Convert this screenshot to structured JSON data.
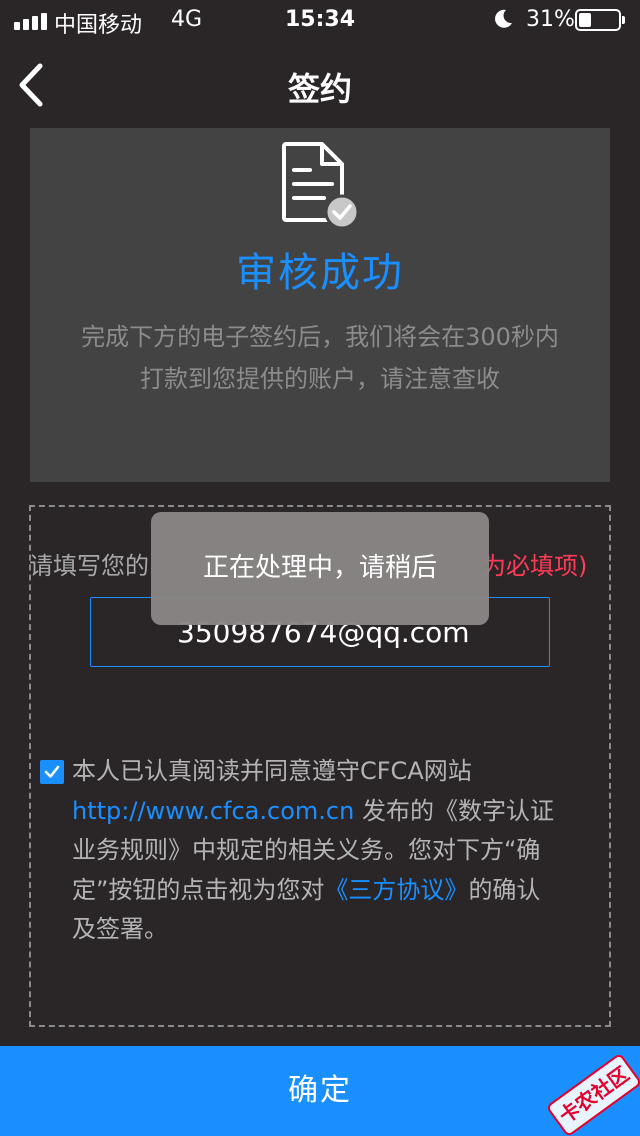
{
  "status_bar": {
    "carrier": "中国移动",
    "network": "4G",
    "time": "15:34",
    "battery": "31%",
    "battery_level": 0.31
  },
  "nav": {
    "title": "签约"
  },
  "card": {
    "headline": "审核成功",
    "description_line1": "完成下方的电子签约后，我们将会在300秒内",
    "description_line2": "打款到您提供的账户，请注意查收"
  },
  "form": {
    "label": "请填写您的",
    "required_note": "为必填项)",
    "email_value": "350987674@qq.com"
  },
  "agreement": {
    "checked": true,
    "text_1": "本人已认真阅读并同意遵守CFCA网站",
    "link_url": "http://www.cfca.com.cn",
    "text_2": " 发布的《数字认证业务规则》中规定的相关义务。您对下方“确定”按钮的点击视为您对",
    "link_agreement": "《三方协议》",
    "text_3": "的确认及签署。"
  },
  "toast": {
    "message": "正在处理中，请稍后"
  },
  "footer": {
    "confirm_label": "确定"
  },
  "watermark": {
    "text": "卡农社区"
  },
  "colors": {
    "accent": "#1a8fff",
    "required": "#ff3b57",
    "background": "#2a2628",
    "card": "#434343"
  }
}
